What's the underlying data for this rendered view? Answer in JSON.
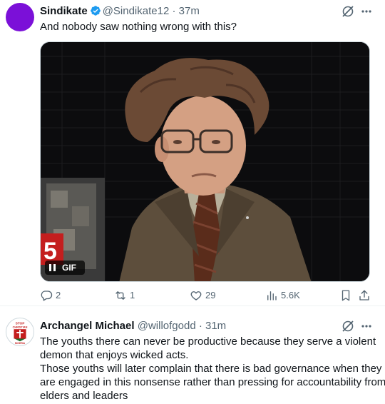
{
  "tweets": [
    {
      "author_name": "Sindikate",
      "handle": "@Sindikate12",
      "separator": "·",
      "time": "37m",
      "verified": true,
      "text": "And nobody saw nothing wrong with this?",
      "media": {
        "type": "GIF",
        "label": "GIF",
        "overlay_logo": "5"
      },
      "actions": {
        "replies": "2",
        "reposts": "1",
        "likes": "29",
        "views": "5.6K"
      }
    },
    {
      "author_name": "Archangel Michael",
      "handle": "@willofgodd",
      "separator": "·",
      "time": "31m",
      "avatar_text": {
        "top": "STOP",
        "middle": "CHRISTIAN",
        "bottom": "NIGERIA"
      },
      "text_lines": [
        "The youths there can never be productive because they serve a violent",
        "demon that enjoys wicked acts.",
        "Those youths will later complain that there is bad governance when they",
        "are engaged in this nonsense rather than pressing for accountability from",
        "elders and leaders"
      ]
    }
  ],
  "colors": {
    "text_primary": "#0f1419",
    "text_secondary": "#536471",
    "verified": "#1d9bf0",
    "border": "#eff3f4",
    "avatar1": "#7b10d8"
  },
  "icons": [
    "grok-icon",
    "more-icon",
    "verified-badge-icon",
    "reply-icon",
    "repost-icon",
    "like-icon",
    "views-icon",
    "bookmark-icon",
    "share-icon",
    "pause-icon"
  ]
}
